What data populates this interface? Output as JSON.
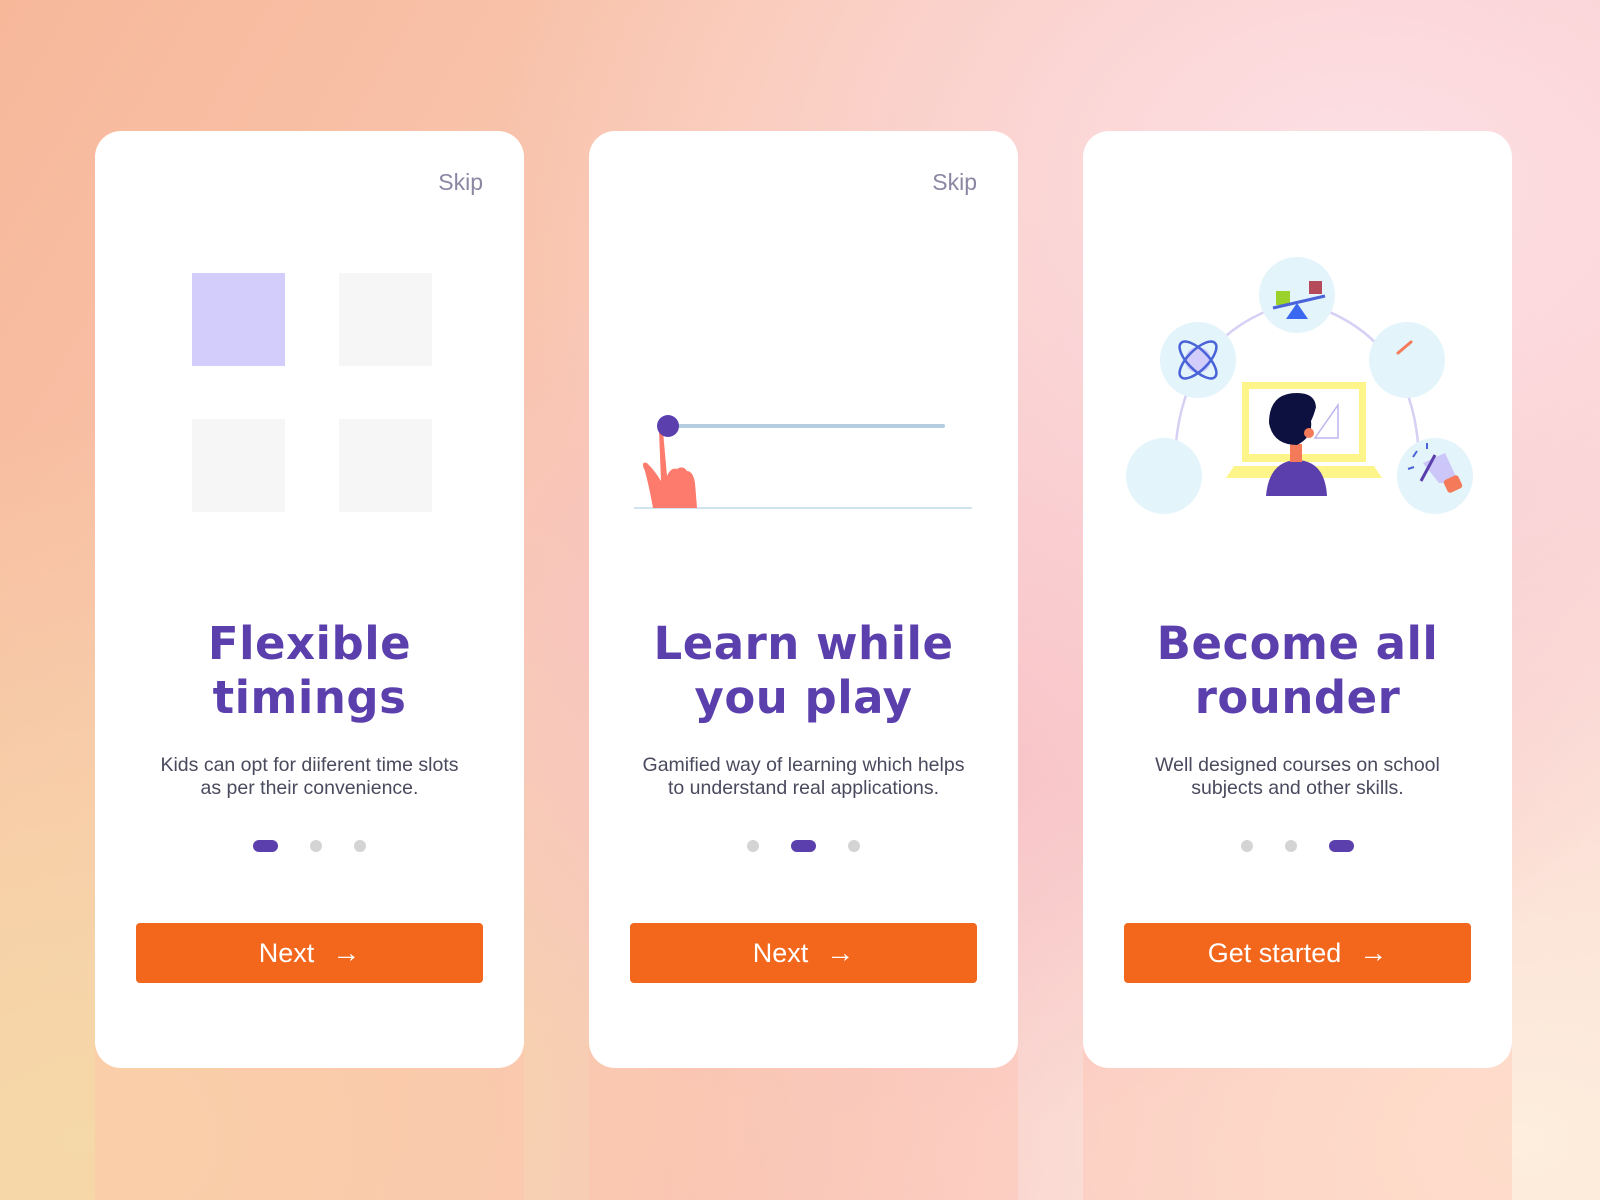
{
  "colors": {
    "title": "#5a3fad",
    "button": "#f2671c",
    "dot_active": "#5a3fad",
    "dot_inactive": "#d4d4d4",
    "skip": "#8a87a3"
  },
  "cards": [
    {
      "skip_label": "Skip",
      "title_line1": "Flexible",
      "title_line2": "timings",
      "desc_line1": "Kids can opt for diiferent time slots",
      "desc_line2": "as per their convenience.",
      "active_dot": 1,
      "button_label": "Next",
      "button_icon": "arrow-right-icon",
      "illustration": "time-slot-grid"
    },
    {
      "skip_label": "Skip",
      "title_line1": "Learn while",
      "title_line2": "you play",
      "desc_line1": "Gamified way of learning which helps",
      "desc_line2": "to understand real applications.",
      "active_dot": 2,
      "button_label": "Next",
      "button_icon": "arrow-right-icon",
      "illustration": "finger-slider"
    },
    {
      "title_line1": "Become all",
      "title_line2": "rounder",
      "desc_line1": "Well designed courses on school",
      "desc_line2": "subjects and other skills.",
      "active_dot": 3,
      "button_label": "Get started",
      "button_icon": "arrow-right-icon",
      "illustration": "student-at-laptop-with-subjects"
    }
  ],
  "arrow_glyph": "→"
}
